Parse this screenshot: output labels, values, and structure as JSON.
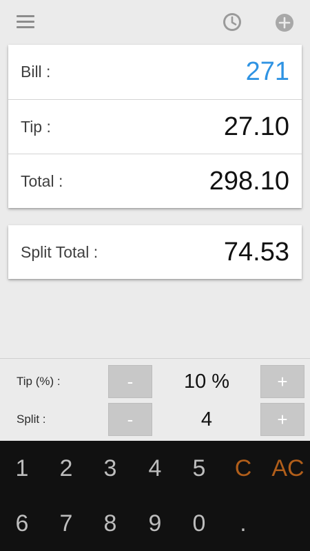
{
  "toolbar": {
    "menu_icon": "menu-icon",
    "history_icon": "history-clock-icon",
    "add_icon": "add-circle-icon"
  },
  "summary": {
    "bill_label": "Bill :",
    "bill_value": "271",
    "tip_label": "Tip :",
    "tip_value": "27.10",
    "total_label": "Total :",
    "total_value": "298.10"
  },
  "split_card": {
    "label": "Split Total :",
    "value": "74.53"
  },
  "controls": {
    "tip_label": "Tip (%) :",
    "tip_value": "10 %",
    "split_label": "Split :",
    "split_value": "4",
    "minus": "-",
    "plus": "+"
  },
  "keypad": {
    "row1": [
      "1",
      "2",
      "3",
      "4",
      "5",
      "C",
      "AC"
    ],
    "row2": [
      "6",
      "7",
      "8",
      "9",
      "0",
      "."
    ]
  },
  "colors": {
    "bill_value": "#2f93e3",
    "accent_keys": "#b15e1a",
    "keypad_bg": "#111111",
    "app_bg": "#ebebeb"
  }
}
